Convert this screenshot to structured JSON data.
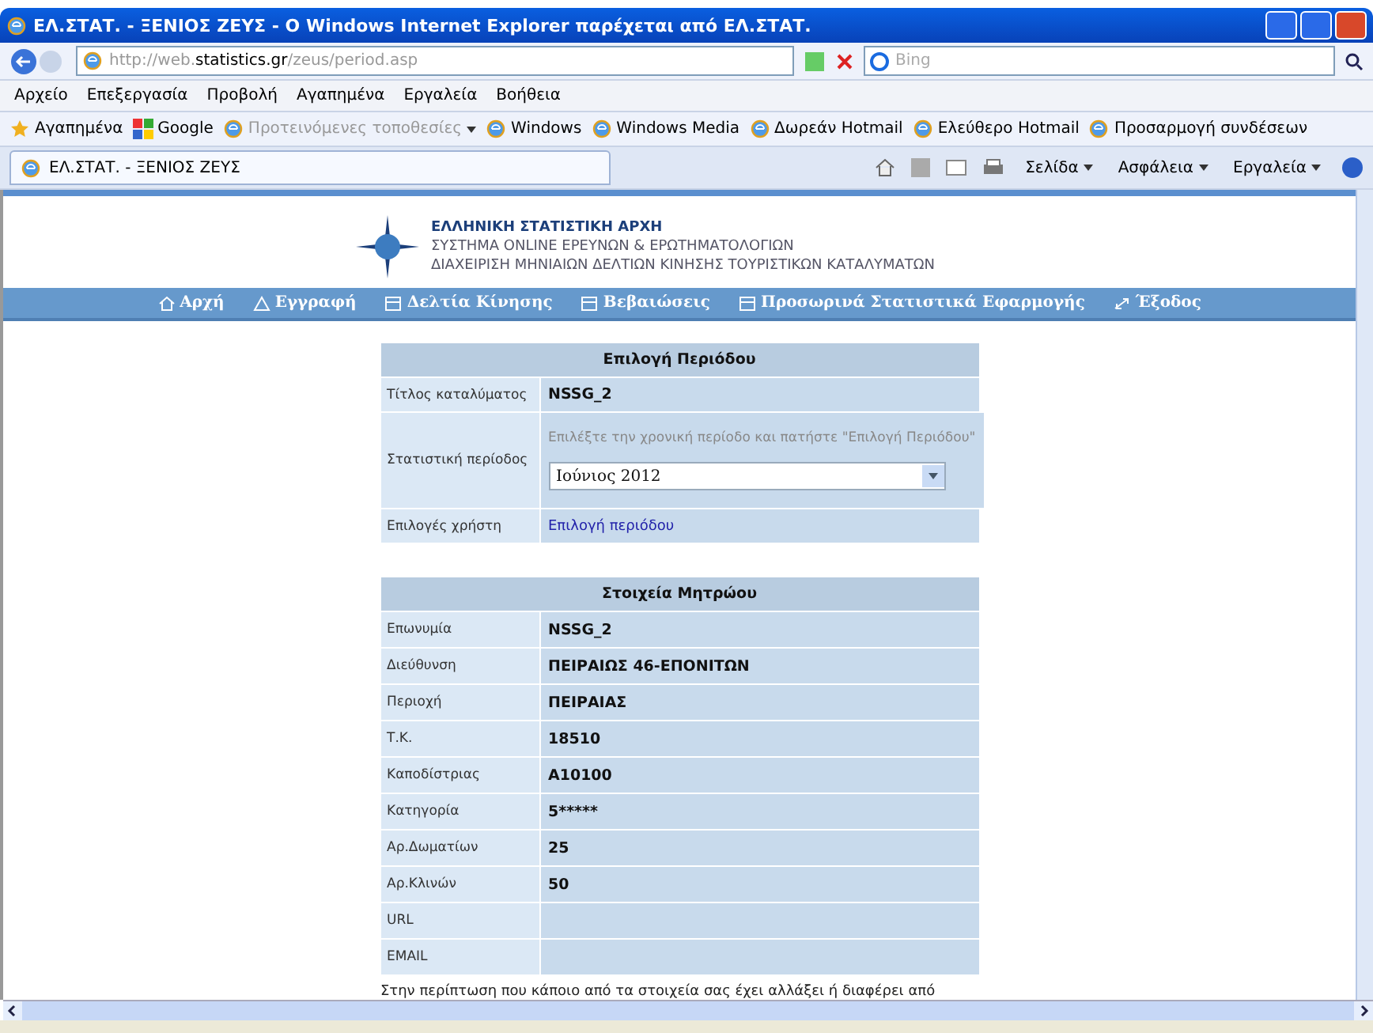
{
  "browser": {
    "title": "ΕΛ.ΣΤΑΤ. - ΞΕΝΙΟΣ ΖΕΥΣ - Ο Windows Internet Explorer παρέχεται από ΕΛ.ΣΤΑΤ.",
    "address": {
      "prefix": "http://web.",
      "domain": "statistics.gr",
      "path": "/zeus/period.asp"
    },
    "search_placeholder": "Bing",
    "menu": [
      "Αρχείο",
      "Επεξεργασία",
      "Προβολή",
      "Αγαπημένα",
      "Εργαλεία",
      "Βοήθεια"
    ],
    "favorites_button": "Αγαπημένα",
    "favorites": [
      {
        "label": "Google",
        "kind": "google",
        "dimmed": false,
        "dropdown": false
      },
      {
        "label": "Προτεινόμενες τοποθεσίες",
        "kind": "ie",
        "dimmed": true,
        "dropdown": true
      },
      {
        "label": "Windows",
        "kind": "ie",
        "dimmed": false,
        "dropdown": false
      },
      {
        "label": "Windows Media",
        "kind": "ie",
        "dimmed": false,
        "dropdown": false
      },
      {
        "label": "Δωρεάν Hotmail",
        "kind": "ie",
        "dimmed": false,
        "dropdown": false
      },
      {
        "label": "Ελεύθερο Hotmail",
        "kind": "ie",
        "dimmed": false,
        "dropdown": false
      },
      {
        "label": "Προσαρμογή συνδέσεων",
        "kind": "ie",
        "dimmed": false,
        "dropdown": false
      }
    ],
    "tab": {
      "label": "ΕΛ.ΣΤΑΤ. - ΞΕΝΙΟΣ ΖΕΥΣ",
      "selected": true
    },
    "commands": [
      "Σελίδα",
      "Ασφάλεια",
      "Εργαλεία"
    ]
  },
  "page": {
    "header": {
      "title": "ΕΛΛΗΝΙΚΗ ΣΤΑΤΙΣΤΙΚΗ ΑΡΧΗ",
      "subtitle": "ΣΥΣΤΗΜΑ ONLINE ΕΡΕΥΝΩΝ & ΕΡΩΤΗΜΑΤΟΛΟΓΙΩΝ",
      "subtitle_2": "ΔΙΑΧΕΙΡΙΣΗ ΜΗΝΙΑΙΩΝ ΔΕΛΤΙΩΝ ΚΙΝΗΣΗΣ ΤΟΥΡΙΣΤΙΚΩΝ ΚΑΤΑΛΥΜΑΤΩΝ"
    },
    "nav": [
      {
        "label": "Αρχή",
        "kind": "home"
      },
      {
        "label": "Εγγραφή",
        "kind": "register"
      },
      {
        "label": "Δελτία Κίνησης",
        "kind": "form"
      },
      {
        "label": "Βεβαιώσεις",
        "kind": "form"
      },
      {
        "label": "Προσωρινά Στατιστικά Εφαρμογής",
        "kind": "form"
      },
      {
        "label": "Έξοδος",
        "kind": "exit"
      }
    ],
    "period": {
      "title": "Επιλογή Περιόδου",
      "rows": [
        {
          "kind": "text",
          "label": "Τίτλος καταλύματος",
          "value": "NSSG_2"
        },
        {
          "kind": "select",
          "label": "Στατιστική περίοδος",
          "hint": "Επιλέξτε την χρονική περίοδο και πατήστε \"Επιλογή Περιόδου\"",
          "value": "Ιούνιος 2012"
        },
        {
          "kind": "link",
          "label": "Επιλογές χρήστη",
          "value": "Επιλογή περιόδου"
        }
      ]
    },
    "registry": {
      "title": "Στοιχεία Μητρώου",
      "rows": [
        {
          "label": "Επωνυμία",
          "value": "NSSG_2"
        },
        {
          "label": "Διεύθυνση",
          "value": "ΠΕΙΡΑΙΩΣ 46-ΕΠΟΝΙΤΩΝ"
        },
        {
          "label": "Περιοχή",
          "value": "ΠΕΙΡΑΙΑΣ"
        },
        {
          "label": "Τ.Κ.",
          "value": "18510"
        },
        {
          "label": "Καποδίστριας",
          "value": "Α10100"
        },
        {
          "label": "Κατηγορία",
          "value": "5*****"
        },
        {
          "label": "Αρ.Δωματίων",
          "value": "25"
        },
        {
          "label": "Αρ.Κλινών",
          "value": "50"
        },
        {
          "label": "URL",
          "value": ""
        },
        {
          "label": "EMAIL",
          "value": ""
        }
      ]
    },
    "note": "Στην περίπτωση που κάποιο από τα στοιχεία σας έχει αλλάξει ή διαφέρει από"
  }
}
